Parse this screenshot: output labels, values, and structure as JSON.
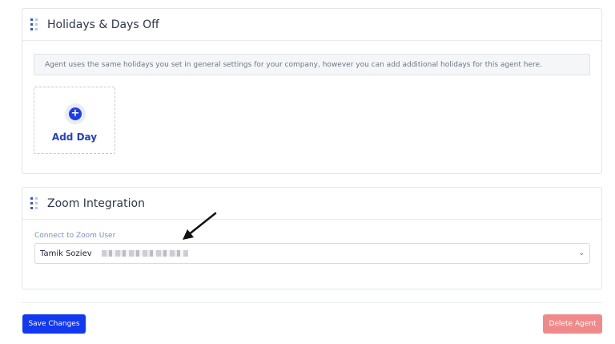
{
  "holidays": {
    "title": "Holidays & Days Off",
    "info": "Agent uses the same holidays you set in general settings for your company, however you can add additional holidays for this agent here.",
    "add_day_label": "Add Day",
    "plus_icon": "plus-circle-icon"
  },
  "zoom": {
    "title": "Zoom Integration",
    "field_label": "Connect to Zoom User",
    "selected_user": "Tamik Soziev",
    "chevron_icon": "chevron-down-icon"
  },
  "footer": {
    "save_label": "Save Changes",
    "delete_label": "Delete Agent"
  },
  "colors": {
    "accent": "#1238f0",
    "danger": "#f08a8a",
    "handle": "#3659c9"
  }
}
